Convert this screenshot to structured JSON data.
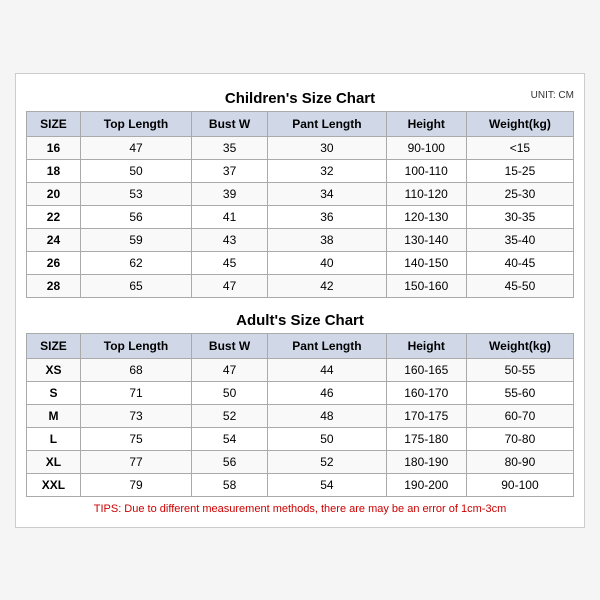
{
  "children_title": "Children's Size Chart",
  "adult_title": "Adult's Size Chart",
  "unit": "UNIT: CM",
  "columns": [
    "SIZE",
    "Top Length",
    "Bust W",
    "Pant Length",
    "Height",
    "Weight(kg)"
  ],
  "children_rows": [
    [
      "16",
      "47",
      "35",
      "30",
      "90-100",
      "<15"
    ],
    [
      "18",
      "50",
      "37",
      "32",
      "100-110",
      "15-25"
    ],
    [
      "20",
      "53",
      "39",
      "34",
      "110-120",
      "25-30"
    ],
    [
      "22",
      "56",
      "41",
      "36",
      "120-130",
      "30-35"
    ],
    [
      "24",
      "59",
      "43",
      "38",
      "130-140",
      "35-40"
    ],
    [
      "26",
      "62",
      "45",
      "40",
      "140-150",
      "40-45"
    ],
    [
      "28",
      "65",
      "47",
      "42",
      "150-160",
      "45-50"
    ]
  ],
  "adult_rows": [
    [
      "XS",
      "68",
      "47",
      "44",
      "160-165",
      "50-55"
    ],
    [
      "S",
      "71",
      "50",
      "46",
      "160-170",
      "55-60"
    ],
    [
      "M",
      "73",
      "52",
      "48",
      "170-175",
      "60-70"
    ],
    [
      "L",
      "75",
      "54",
      "50",
      "175-180",
      "70-80"
    ],
    [
      "XL",
      "77",
      "56",
      "52",
      "180-190",
      "80-90"
    ],
    [
      "XXL",
      "79",
      "58",
      "54",
      "190-200",
      "90-100"
    ]
  ],
  "tips": "TIPS: Due to different measurement methods, there are may be an error of 1cm-3cm"
}
